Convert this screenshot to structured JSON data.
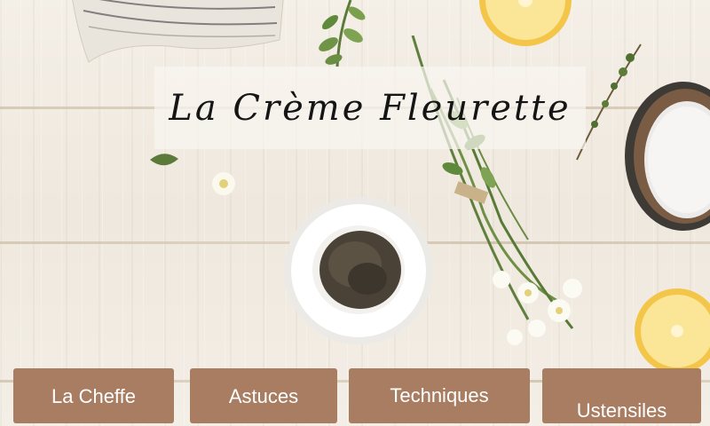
{
  "header": {
    "title": "La Crème Fleurette"
  },
  "nav": {
    "buttons": [
      {
        "label": "La Cheffe"
      },
      {
        "label": "Astuces"
      },
      {
        "label": "Techniques"
      },
      {
        "label": "Ustensiles"
      }
    ]
  },
  "colors": {
    "button_background": "#a87d62",
    "button_text": "#ffffff",
    "wood_background": "#f1ece4",
    "title_text": "#151515"
  },
  "icons": [
    "linen-towel",
    "herb-sprig",
    "lemon-half",
    "thyme-bouquet",
    "lavender-bowl",
    "salt-bowl",
    "chamomile-flower"
  ]
}
